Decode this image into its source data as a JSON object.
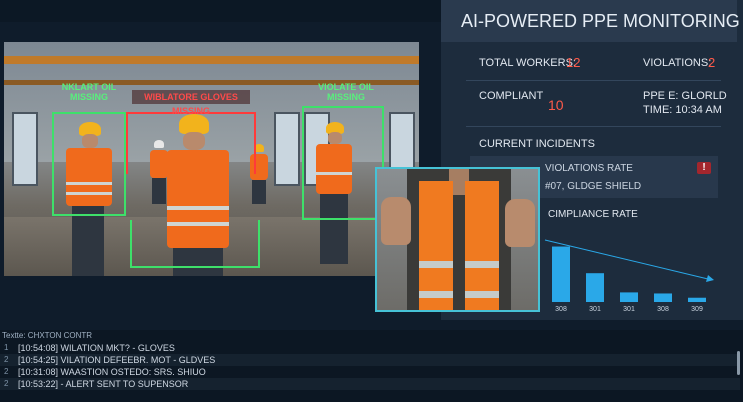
{
  "panel": {
    "title": "AI-POWERED PPE MONITORING",
    "total_workers_label": "TOTAL WORKERS:",
    "total_workers_value": "12",
    "violations_label": "VIOLATIONS:",
    "violations_value": "2",
    "compliant_label": "COMPLIANT",
    "compliant_value": "10",
    "ppe_line1": "PPE E: GLORLD",
    "ppe_line2": "TIME: 10:34 AM",
    "incidents_title": "CURRENT INCIDENTS",
    "incident_line1": "VIOLATIONS RATE",
    "incident_line2": "#07, GLDGE SHIELD",
    "compliance_title": "CIMPLIANCE RATE"
  },
  "feed": {
    "label_left": [
      "NKLART OIL",
      "MISSING"
    ],
    "label_red": "WIBLATORE GLOVES MISSING",
    "label_right": [
      "VIOLATE OIL",
      "MISSING"
    ]
  },
  "chart_data": {
    "type": "bar",
    "categories": [
      "308",
      "301",
      "301",
      "308",
      "309"
    ],
    "values": [
      52,
      27,
      9,
      8,
      4
    ],
    "title": "CIMPLIANCE RATE",
    "ylim": [
      0,
      60
    ]
  },
  "log": {
    "header": "Textte: CHXTON CONTR",
    "rows": [
      {
        "num": "1",
        "text": "[10:54:08]  WILATION  MKT? - GLOVES"
      },
      {
        "num": "2",
        "text": "[10:54:25]  VILATION DEFEEBR. MOT - GLDVES"
      },
      {
        "num": "2",
        "text": "[10:31:08]  WAASTION OSTEDO: SRS. SHIUO"
      },
      {
        "num": "2",
        "text": "[10:53:22]  -  ALERT SENT TO SUPENSOR"
      }
    ]
  },
  "colors": {
    "accent_red": "#ff5a4a",
    "box_green": "#3ee06a",
    "bar_blue": "#2aa8e8",
    "inset_border": "#46c2d6"
  }
}
